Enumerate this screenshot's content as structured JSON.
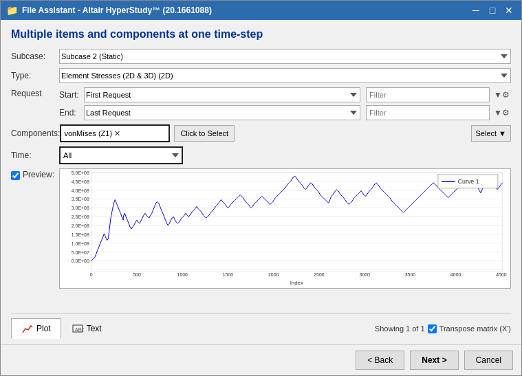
{
  "window": {
    "title": "File Assistant - Altair HyperStudy™ (20.1661088)",
    "icon": "📁"
  },
  "page_title": "Multiple items and components at one time-step",
  "form": {
    "subcase_label": "Subcase:",
    "subcase_value": "Subcase 2 (Static)",
    "type_label": "Type:",
    "type_value": "Element Stresses (2D & 3D) (2D)",
    "request_label": "Request",
    "start_label": "Start:",
    "start_value": "First Request",
    "start_filter_placeholder": "Filter",
    "end_label": "End:",
    "end_value": "Last Request",
    "end_filter_placeholder": "Filter",
    "components_label": "Components:",
    "component_tag": "vonMises (Z1)",
    "click_to_select": "Click to Select",
    "select_label": "Select",
    "time_label": "Time:",
    "time_value": "All",
    "preview_label": "Preview:"
  },
  "chart": {
    "legend_label": "Curve 1",
    "x_axis_label": "Index",
    "y_labels": [
      "5.0E+08",
      "4.5E+08",
      "4.0E+08",
      "3.5E+08",
      "3.0E+08",
      "2.5E+08",
      "2.0E+08",
      "1.5E+08",
      "1.0E+08",
      "5.0E+07",
      "0.0E+00"
    ],
    "x_labels": [
      "0",
      "500",
      "1000",
      "1500",
      "2000",
      "2500",
      "3000",
      "3500",
      "4000",
      "4500"
    ]
  },
  "tabs": {
    "plot_label": "Plot",
    "text_label": "Text",
    "showing_text": "Showing 1 of 1",
    "transpose_label": "Transpose matrix (X')"
  },
  "footer": {
    "back_label": "< Back",
    "next_label": "Next >",
    "cancel_label": "Cancel"
  }
}
